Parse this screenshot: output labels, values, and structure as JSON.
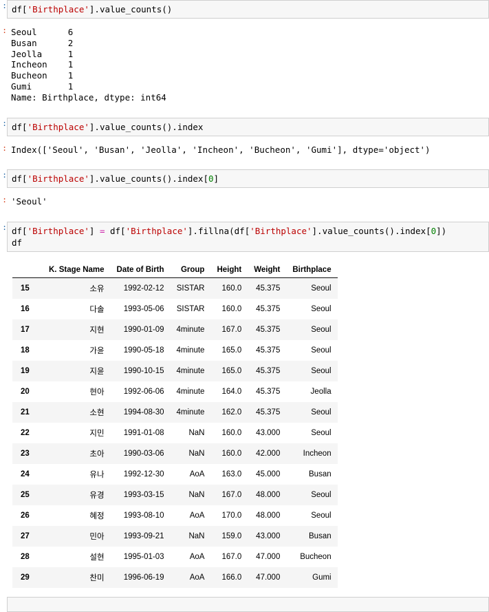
{
  "notebook": {
    "prompt_in": ":",
    "prompt_out": ":",
    "cells": [
      {
        "code_prefix": "df[",
        "code_str1": "'Birthplace'",
        "code_mid": "].value_counts()",
        "output": "Seoul      6\nBusan      2\nJeolla     1\nIncheon    1\nBucheon    1\nGumi       1\nName: Birthplace, dtype: int64"
      },
      {
        "code_prefix": "df[",
        "code_str1": "'Birthplace'",
        "code_mid": "].value_counts().index",
        "output": "Index(['Seoul', 'Busan', 'Jeolla', 'Incheon', 'Bucheon', 'Gumi'], dtype='object')"
      },
      {
        "code_prefix": "df[",
        "code_str1": "'Birthplace'",
        "code_mid": "].value_counts().index[",
        "code_num": "0",
        "code_suffix": "]",
        "output": "'Seoul'"
      }
    ],
    "assign_cell": {
      "p1": "df[",
      "s1": "'Birthplace'",
      "p2": "] ",
      "op": "=",
      "p3": " df[",
      "s2": "'Birthplace'",
      "p4": "].fillna(df[",
      "s3": "'Birthplace'",
      "p5": "].value_counts().index[",
      "n1": "0",
      "p6": "])",
      "line2": "df"
    }
  },
  "dataframe": {
    "index_header": "",
    "columns": [
      "K. Stage Name",
      "Date of Birth",
      "Group",
      "Height",
      "Weight",
      "Birthplace"
    ],
    "index": [
      "15",
      "16",
      "17",
      "18",
      "19",
      "20",
      "21",
      "22",
      "23",
      "24",
      "25",
      "26",
      "27",
      "28",
      "29"
    ],
    "rows": [
      [
        "소유",
        "1992-02-12",
        "SISTAR",
        "160.0",
        "45.375",
        "Seoul"
      ],
      [
        "다솔",
        "1993-05-06",
        "SISTAR",
        "160.0",
        "45.375",
        "Seoul"
      ],
      [
        "지현",
        "1990-01-09",
        "4minute",
        "167.0",
        "45.375",
        "Seoul"
      ],
      [
        "가윤",
        "1990-05-18",
        "4minute",
        "165.0",
        "45.375",
        "Seoul"
      ],
      [
        "지윤",
        "1990-10-15",
        "4minute",
        "165.0",
        "45.375",
        "Seoul"
      ],
      [
        "현아",
        "1992-06-06",
        "4minute",
        "164.0",
        "45.375",
        "Jeolla"
      ],
      [
        "소현",
        "1994-08-30",
        "4minute",
        "162.0",
        "45.375",
        "Seoul"
      ],
      [
        "지민",
        "1991-01-08",
        "NaN",
        "160.0",
        "43.000",
        "Seoul"
      ],
      [
        "초아",
        "1990-03-06",
        "NaN",
        "160.0",
        "42.000",
        "Incheon"
      ],
      [
        "유나",
        "1992-12-30",
        "AoA",
        "163.0",
        "45.000",
        "Busan"
      ],
      [
        "유경",
        "1993-03-15",
        "NaN",
        "167.0",
        "48.000",
        "Seoul"
      ],
      [
        "혜정",
        "1993-08-10",
        "AoA",
        "170.0",
        "48.000",
        "Seoul"
      ],
      [
        "민아",
        "1993-09-21",
        "NaN",
        "159.0",
        "43.000",
        "Busan"
      ],
      [
        "설현",
        "1995-01-03",
        "AoA",
        "167.0",
        "47.000",
        "Bucheon"
      ],
      [
        "찬미",
        "1996-06-19",
        "AoA",
        "166.0",
        "47.000",
        "Gumi"
      ]
    ]
  },
  "colors": {
    "string_token": "#bb0000",
    "number_token": "#008000",
    "operator_token": "#cc22aa",
    "prompt_in": "#2f6fab",
    "prompt_out": "#d64521",
    "cell_bg": "#f7f7f7",
    "cell_border": "#cfcfcf",
    "row_stripe": "#f5f5f5"
  }
}
